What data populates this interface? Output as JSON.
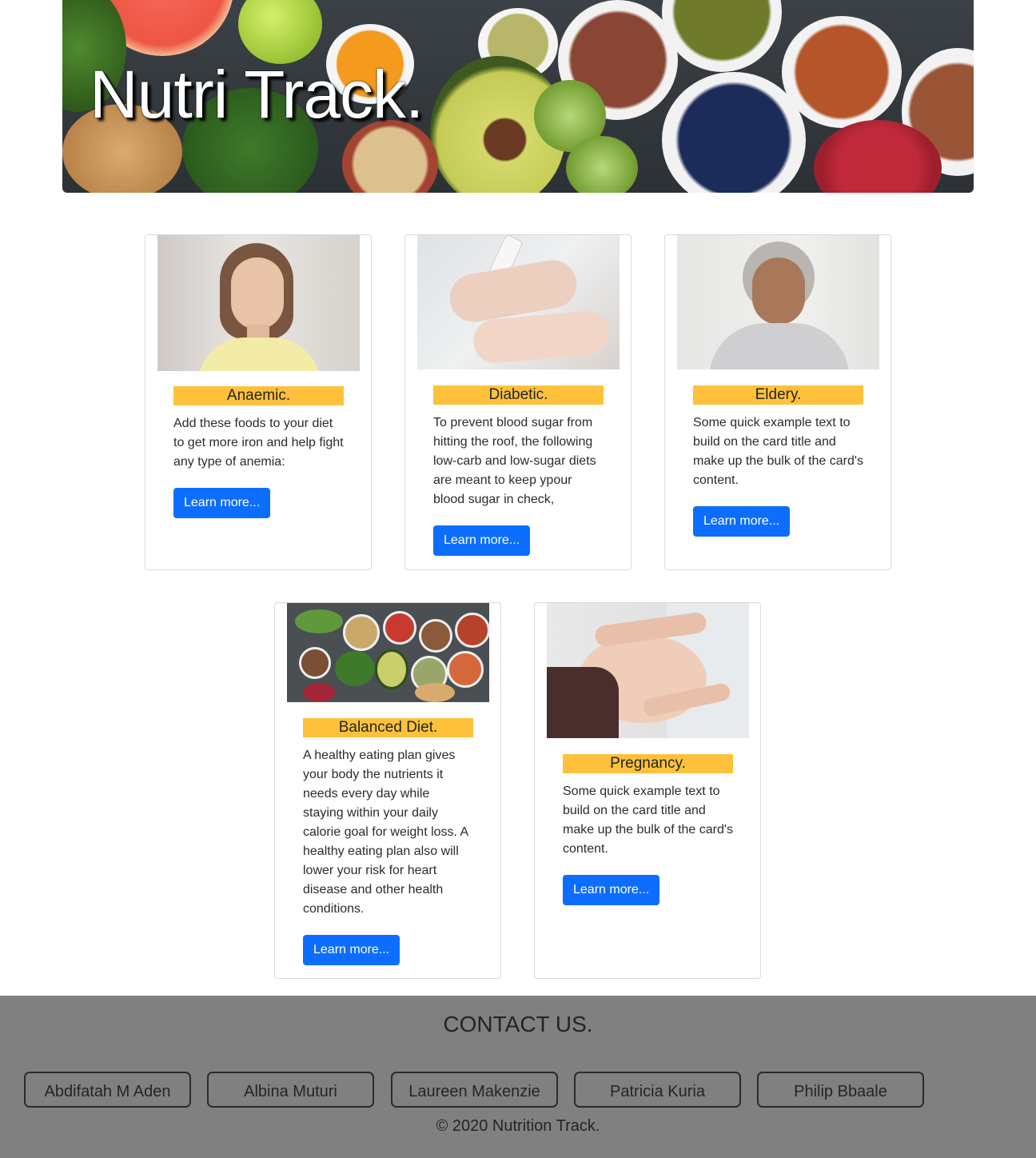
{
  "hero": {
    "title": "Nutri Track."
  },
  "cards": [
    {
      "title": "Anaemic.",
      "text": "Add these foods to your diet to get more iron and help fight any type of anemia:",
      "button": "Learn more..."
    },
    {
      "title": "Diabetic.",
      "text": "To prevent blood sugar from hitting the roof, the following low-carb and low-sugar diets are meant to keep ypour blood sugar in check,",
      "button": "Learn more..."
    },
    {
      "title": "Eldery.",
      "text": "Some quick example text to build on the card title and make up the bulk of the card's content.",
      "button": "Learn more..."
    },
    {
      "title": "Balanced Diet.",
      "text": "A healthy eating plan gives your body the nutrients it needs every day while staying within your daily calorie goal for weight loss. A healthy eating plan also will lower your risk for heart disease and other health conditions.",
      "button": "Learn more..."
    },
    {
      "title": "Pregnancy.",
      "text": "Some quick example text to build on the card title and make up the bulk of the card's content.",
      "button": "Learn more..."
    }
  ],
  "footer": {
    "heading": "CONTACT US.",
    "contacts": [
      "Abdifatah M Aden",
      "Albina Muturi",
      "Laureen Makenzie",
      "Patricia Kuria",
      "Philip Bbaale"
    ],
    "copyright": "© 2020 Nutrition Track."
  },
  "colors": {
    "title_highlight": "#ffc13b",
    "button_primary": "#0d6efd",
    "footer_background": "#808080"
  }
}
